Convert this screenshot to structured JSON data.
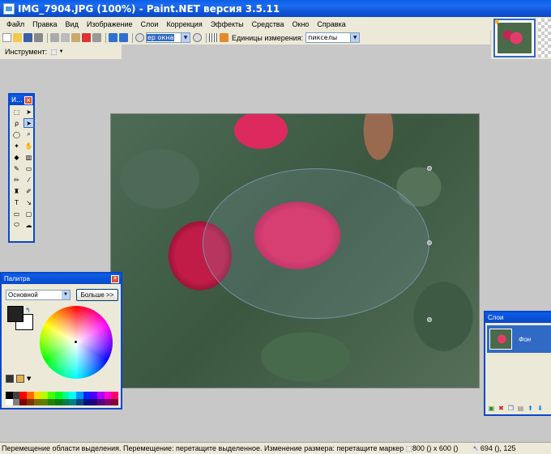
{
  "window": {
    "title": "IMG_7904.JPG (100%) - Paint.NET версия 3.5.11"
  },
  "menu": [
    "Файл",
    "Правка",
    "Вид",
    "Изображение",
    "Слои",
    "Коррекция",
    "Эффекты",
    "Средства",
    "Окно",
    "Справка"
  ],
  "toolbar": {
    "zoom_value": "ер окна",
    "units_label": "Единицы измерения:",
    "units_value": "пикселы",
    "tool_label": "Инструмент:"
  },
  "tools_window": {
    "title": "И..."
  },
  "palette_window": {
    "title": "Палитра",
    "mode": "Основной",
    "more_button": "Больше >>",
    "primary_color": "#222222",
    "secondary_color": "#ffffff",
    "swatch_colors": [
      "#000000",
      "#404040",
      "#ff0000",
      "#ff6a00",
      "#ffd800",
      "#b6ff00",
      "#4cff00",
      "#00ff21",
      "#00ff90",
      "#00ffff",
      "#0094ff",
      "#0026ff",
      "#4800ff",
      "#b200ff",
      "#ff00dc",
      "#ff006e",
      "#ffffff",
      "#808080",
      "#7f0000",
      "#7f3300",
      "#7f6a00",
      "#5b7f00",
      "#267f00",
      "#007f0e",
      "#007f46",
      "#007f7f",
      "#004a7f",
      "#00137f",
      "#21007f",
      "#57007f",
      "#7f006e",
      "#7f0037"
    ]
  },
  "layers_window": {
    "title": "Слои",
    "layer_name": "Фон"
  },
  "statusbar": {
    "message": "Перемещение области выделения. Перемещение: перетащите выделенное. Изменение размера: перетащите маркер",
    "selection_size": "800 () x 600 ()",
    "cursor_pos": "694 (), 125"
  }
}
